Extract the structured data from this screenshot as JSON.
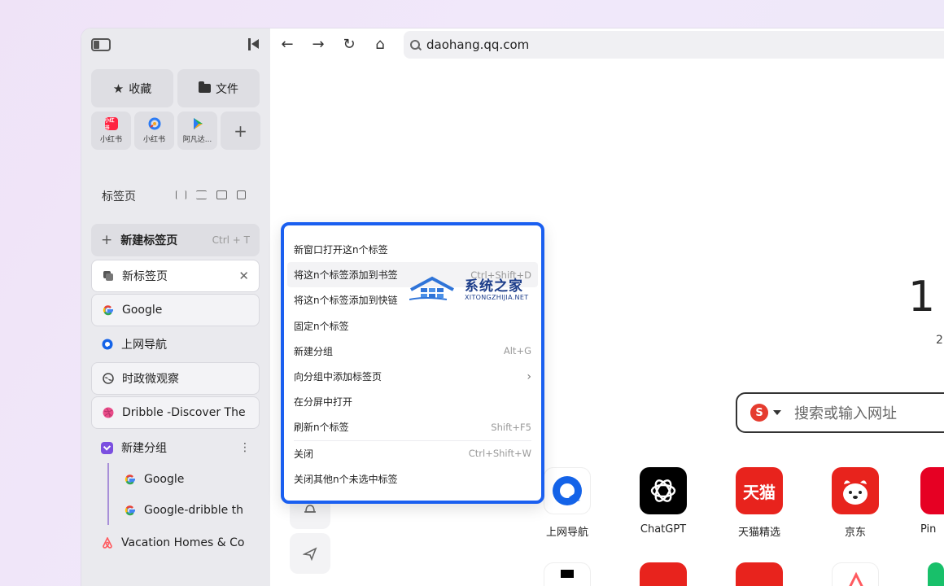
{
  "sidebar": {
    "favorites_label": "收藏",
    "files_label": "文件",
    "pins": [
      {
        "label": "小红书",
        "badge": "小红书",
        "color": "#ff2442"
      },
      {
        "label": "小红书",
        "color": "#2b7bf5"
      },
      {
        "label": "阿凡达...",
        "color": "#18b45a"
      }
    ],
    "pin_add": "+",
    "tabs_title": "标签页",
    "new_tab_plus": "+",
    "new_tab_label": "新建标签页",
    "new_tab_shortcut": "Ctrl + T",
    "tabs": [
      {
        "label": "新标签页",
        "icon": "tab-page-icon",
        "close": "✕"
      },
      {
        "label": "Google",
        "icon": "google-icon"
      },
      {
        "label": "上网导航",
        "icon": "qq-nav-icon"
      },
      {
        "label": "时政微观察",
        "icon": "globe-icon"
      },
      {
        "label": "Dribble -Discover The",
        "icon": "dribbble-icon"
      }
    ],
    "group": {
      "label": "新建分组",
      "more": "⋮",
      "children": [
        {
          "label": "Google",
          "icon": "google-icon"
        },
        {
          "label": "Google-dribble th",
          "icon": "google-icon"
        }
      ]
    },
    "last_tab": {
      "label": "Vacation Homes & Co",
      "icon": "airbnb-icon"
    }
  },
  "toolbar": {
    "address": "daohang.qq.com"
  },
  "context_menu": {
    "items": [
      {
        "label": "新窗口打开这n个标签",
        "shortcut": ""
      },
      {
        "label": "将这n个标签添加到书签",
        "shortcut": "Ctrl+Shift+D"
      },
      {
        "label": "将这n个标签添加到快链",
        "shortcut": ""
      },
      {
        "label": "固定n个标签",
        "shortcut": ""
      },
      {
        "label": "新建分组",
        "shortcut": "Alt+G"
      },
      {
        "label": "向分组中添加标签页",
        "shortcut": ""
      },
      {
        "label": "在分屏中打开",
        "shortcut": ""
      },
      {
        "label": "刷新n个标签",
        "shortcut": "Shift+F5"
      },
      {
        "label": "关闭",
        "shortcut": "Ctrl+Shift+W"
      },
      {
        "label": "关闭其他n个未选中标签",
        "shortcut": ""
      }
    ],
    "submenu_arrow": "›"
  },
  "watermark": {
    "title": "系统之家",
    "subtitle": "XITONGZHIJIA.NET"
  },
  "newtab": {
    "clock_partial": "1",
    "date_partial": "2",
    "search_placeholder": "搜索或输入网址",
    "search_engine_icon": "S",
    "sites": [
      {
        "label": "上网导航",
        "color": "#ffffff"
      },
      {
        "label": "ChatGPT",
        "color": "#000000"
      },
      {
        "label": "天猫精选",
        "color": "#e8231d",
        "glyph": "天猫"
      },
      {
        "label": "京东",
        "color": "#e8231d"
      },
      {
        "label": "Pin",
        "color": "#e60023"
      }
    ],
    "second_row_colors": [
      "#ffffff",
      "#e8231d",
      "#e8231d",
      "#ffffff",
      "#18c06a"
    ]
  }
}
